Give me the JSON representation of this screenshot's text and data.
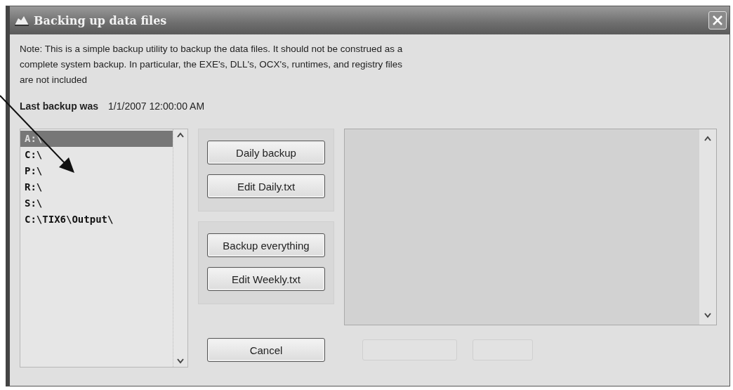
{
  "window": {
    "title": "Backing up data files"
  },
  "note_lines": [
    "Note: This is a simple backup utility to backup the data files. It should not be construed as a",
    "complete system backup. In particular, the EXE's, DLL's, OCX's, runtimes, and registry files",
    "are not included"
  ],
  "last_backup": {
    "label": "Last backup was",
    "value": "1/1/2007 12:00:00 AM"
  },
  "drives": [
    {
      "label": "A:\\",
      "selected": true
    },
    {
      "label": "C:\\",
      "selected": false
    },
    {
      "label": "P:\\",
      "selected": false
    },
    {
      "label": "R:\\",
      "selected": false
    },
    {
      "label": "S:\\",
      "selected": false
    },
    {
      "label": "C:\\TIX6\\Output\\",
      "selected": false
    }
  ],
  "button_groups": [
    {
      "buttons": [
        {
          "label": "Daily backup"
        },
        {
          "label": "Edit Daily.txt"
        }
      ]
    },
    {
      "buttons": [
        {
          "label": "Backup everything"
        },
        {
          "label": "Edit Weekly.txt"
        }
      ]
    }
  ],
  "cancel_button": {
    "label": "Cancel"
  },
  "footer_buttons": [
    {
      "disabled": true
    },
    {
      "disabled": true
    }
  ]
}
